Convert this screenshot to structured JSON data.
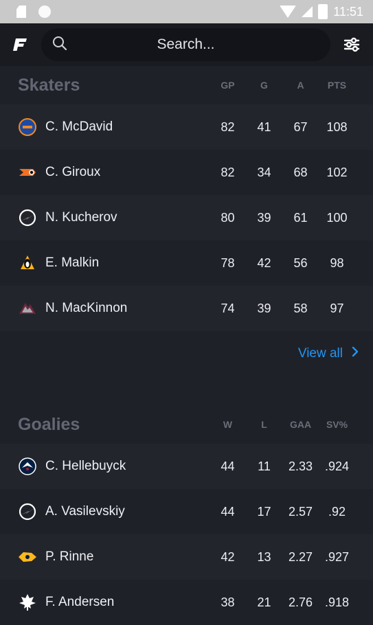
{
  "status_bar": {
    "time": "11:51"
  },
  "search": {
    "placeholder": "Search..."
  },
  "skaters": {
    "title": "Skaters",
    "columns": [
      "GP",
      "G",
      "A",
      "PTS"
    ],
    "rows": [
      {
        "team_icon": "oilers-logo",
        "name": "C. McDavid",
        "values": [
          "82",
          "41",
          "67",
          "108"
        ]
      },
      {
        "team_icon": "flyers-logo",
        "name": "C. Giroux",
        "values": [
          "82",
          "34",
          "68",
          "102"
        ]
      },
      {
        "team_icon": "lightning-logo",
        "name": "N. Kucherov",
        "values": [
          "80",
          "39",
          "61",
          "100"
        ]
      },
      {
        "team_icon": "penguins-logo",
        "name": "E. Malkin",
        "values": [
          "78",
          "42",
          "56",
          "98"
        ]
      },
      {
        "team_icon": "avalanche-logo",
        "name": "N. MacKinnon",
        "values": [
          "74",
          "39",
          "58",
          "97"
        ]
      }
    ],
    "view_all": "View all"
  },
  "goalies": {
    "title": "Goalies",
    "columns": [
      "W",
      "L",
      "GAA",
      "SV%"
    ],
    "rows": [
      {
        "team_icon": "jets-logo",
        "name": "C. Hellebuyck",
        "values": [
          "44",
          "11",
          "2.33",
          ".924"
        ]
      },
      {
        "team_icon": "lightning-logo",
        "name": "A. Vasilevskiy",
        "values": [
          "44",
          "17",
          "2.57",
          ".92"
        ]
      },
      {
        "team_icon": "predators-logo",
        "name": "P. Rinne",
        "values": [
          "42",
          "13",
          "2.27",
          ".927"
        ]
      },
      {
        "team_icon": "maple-leafs-logo",
        "name": "F. Andersen",
        "values": [
          "38",
          "21",
          "2.76",
          ".918"
        ]
      }
    ]
  },
  "colors": {
    "accent": "#2196f3",
    "background": "#1f2129",
    "row_alt": "#23252d"
  }
}
